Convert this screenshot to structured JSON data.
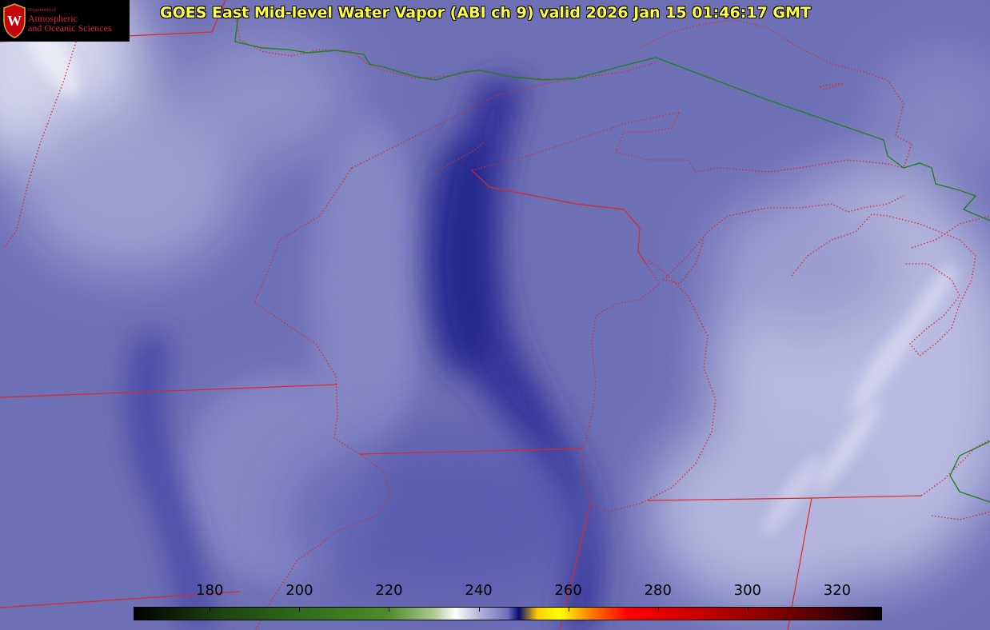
{
  "header": {
    "title": "GOES East Mid-level Water Vapor (ABI ch 9)  valid 2026 Jan 15 01:46:17 GMT"
  },
  "logo": {
    "icon": "uw-crest-icon",
    "seal_letter": "W",
    "dept_label": "Department of",
    "line1": "Atmospheric",
    "line2": "and Oceanic Sciences"
  },
  "colorbar": {
    "ticks": [
      "180",
      "200",
      "220",
      "240",
      "260",
      "280",
      "300",
      "320"
    ],
    "tick_values": [
      180,
      200,
      220,
      240,
      260,
      280,
      300,
      320
    ],
    "range": [
      163,
      330
    ]
  },
  "colors": {
    "title_text": "#ffff40",
    "state_border": "#dc2828",
    "country_border": "#208020",
    "vapor_moist": "#c8cae8",
    "vapor_dry": "#2a2a8e"
  }
}
